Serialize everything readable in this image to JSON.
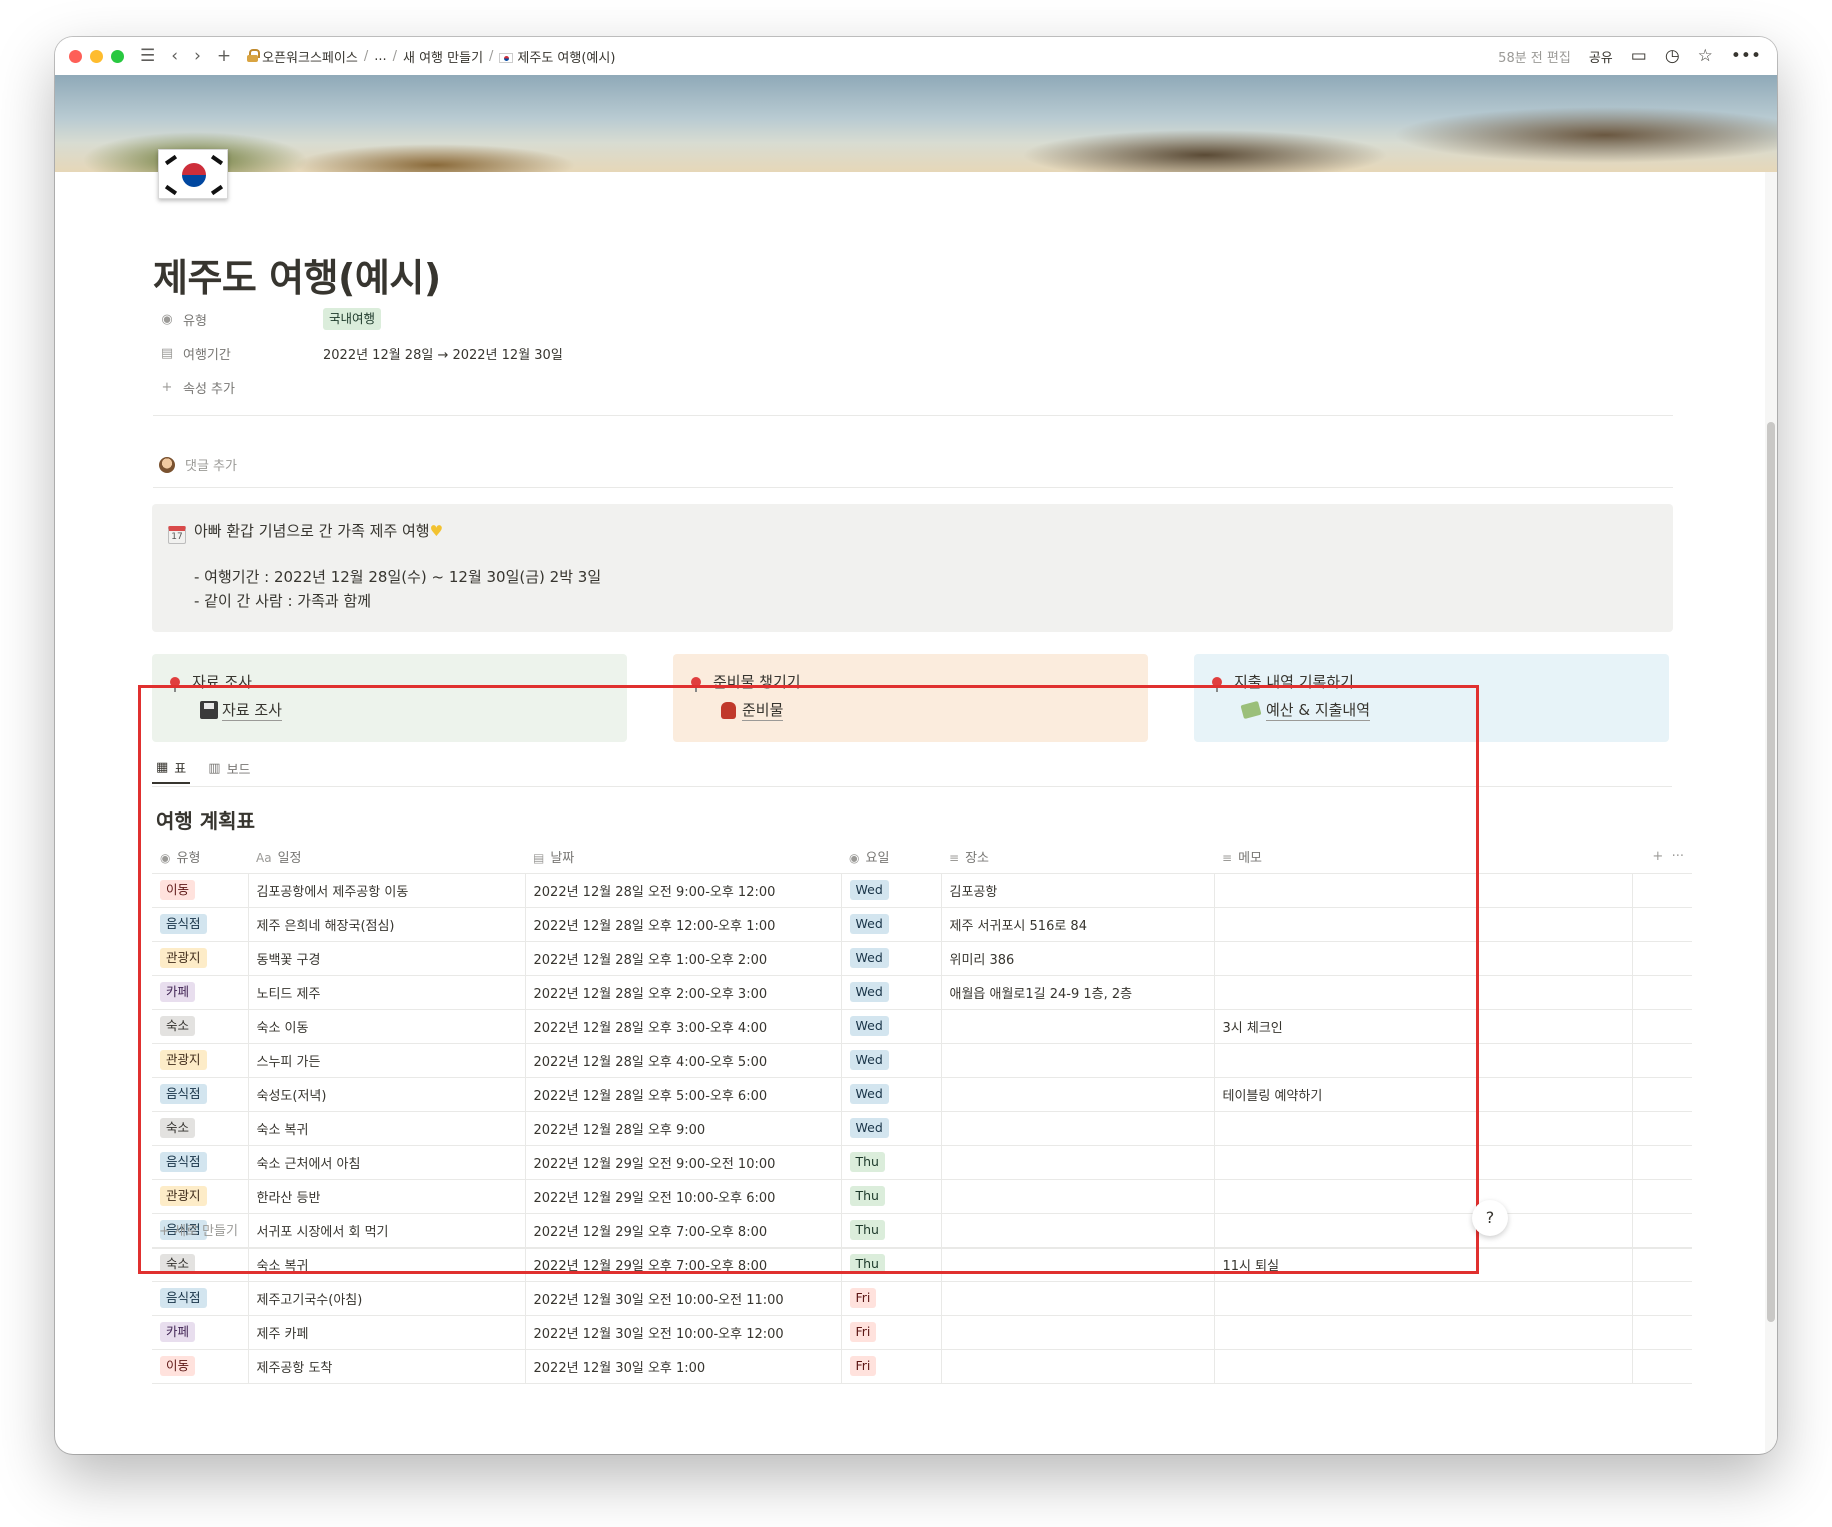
{
  "topbar": {
    "breadcrumbs": [
      "오픈워크스페이스",
      "...",
      "새 여행 만들기",
      "제주도 여행(예시)"
    ],
    "edited": "58분 전 편집",
    "share": "공유"
  },
  "page": {
    "title": "제주도 여행(예시)",
    "properties": [
      {
        "name": "유형",
        "value": "국내여행"
      },
      {
        "name": "여행기간",
        "value": "2022년 12월 28일 → 2022년 12월 30일"
      }
    ],
    "add_property": "속성 추가",
    "add_comment": "댓글 추가"
  },
  "callout": {
    "icon_text": "17",
    "headline": "아빠 환갑 기념으로 간 가족 제주 여행",
    "lines": [
      "- 여행기간 : 2022년 12월 28일(수) ~ 12월 30일(금) 2박 3일",
      "- 같이 간 사람 : 가족과 함께"
    ]
  },
  "cards": [
    {
      "title": "자료 조사",
      "link": "자료 조사"
    },
    {
      "title": "준비물 챙기기",
      "link": "준비물"
    },
    {
      "title": "지출 내역 기록하기",
      "link": "예산 & 지출내역"
    }
  ],
  "database": {
    "tabs": [
      "표",
      "보드"
    ],
    "title": "여행 계획표",
    "columns": [
      "유형",
      "일정",
      "날짜",
      "요일",
      "장소",
      "메모"
    ],
    "column_icon_hint": "Aa",
    "rows": [
      {
        "type": "이동",
        "type_color": "move",
        "name": "김포공항에서 제주공항 이동",
        "date": "2022년 12월 28일 오전 9:00-오후 12:00",
        "day": "Wed",
        "place": "김포공항",
        "memo": ""
      },
      {
        "type": "음식점",
        "type_color": "food",
        "name": "제주 은희네 해장국(점심)",
        "date": "2022년 12월 28일 오후 12:00-오후 1:00",
        "day": "Wed",
        "place": "제주 서귀포시 516로 84",
        "memo": ""
      },
      {
        "type": "관광지",
        "type_color": "sight",
        "name": "동백꽃 구경",
        "date": "2022년 12월 28일 오후 1:00-오후 2:00",
        "day": "Wed",
        "place": "위미리 386",
        "memo": ""
      },
      {
        "type": "카페",
        "type_color": "cafe",
        "name": "노티드 제주",
        "date": "2022년 12월 28일 오후 2:00-오후 3:00",
        "day": "Wed",
        "place": "애월읍 애월로1길 24-9 1층, 2층",
        "memo": ""
      },
      {
        "type": "숙소",
        "type_color": "stay",
        "name": "숙소 이동",
        "date": "2022년 12월 28일 오후 3:00-오후 4:00",
        "day": "Wed",
        "place": "",
        "memo": "3시 체크인"
      },
      {
        "type": "관광지",
        "type_color": "sight",
        "name": "스누피 가든",
        "date": "2022년 12월 28일 오후 4:00-오후 5:00",
        "day": "Wed",
        "place": "",
        "memo": ""
      },
      {
        "type": "음식점",
        "type_color": "food",
        "name": "숙성도(저녁)",
        "date": "2022년 12월 28일 오후 5:00-오후 6:00",
        "day": "Wed",
        "place": "",
        "memo": "테이블링 예약하기"
      },
      {
        "type": "숙소",
        "type_color": "stay",
        "name": "숙소 복귀",
        "date": "2022년 12월 28일 오후 9:00",
        "day": "Wed",
        "place": "",
        "memo": ""
      },
      {
        "type": "음식점",
        "type_color": "food",
        "name": "숙소 근처에서 아침",
        "date": "2022년 12월 29일 오전 9:00-오전 10:00",
        "day": "Thu",
        "place": "",
        "memo": ""
      },
      {
        "type": "관광지",
        "type_color": "sight",
        "name": "한라산 등반",
        "date": "2022년 12월 29일 오전 10:00-오후 6:00",
        "day": "Thu",
        "place": "",
        "memo": ""
      },
      {
        "type": "음식점",
        "type_color": "food",
        "name": "서귀포 시장에서 회 먹기",
        "date": "2022년 12월 29일 오후 7:00-오후 8:00",
        "day": "Thu",
        "place": "",
        "memo": ""
      },
      {
        "type": "숙소",
        "type_color": "stay",
        "name": "숙소 복귀",
        "date": "2022년 12월 29일 오후 7:00-오후 8:00",
        "day": "Thu",
        "place": "",
        "memo": "11시 퇴실"
      },
      {
        "type": "음식점",
        "type_color": "food",
        "name": "제주고기국수(아침)",
        "date": "2022년 12월 30일 오전 10:00-오전 11:00",
        "day": "Fri",
        "place": "",
        "memo": ""
      },
      {
        "type": "카페",
        "type_color": "cafe",
        "name": "제주 카페",
        "date": "2022년 12월 30일 오전 10:00-오후 12:00",
        "day": "Fri",
        "place": "",
        "memo": ""
      },
      {
        "type": "이동",
        "type_color": "move",
        "name": "제주공항 도착",
        "date": "2022년 12월 30일 오후 1:00",
        "day": "Fri",
        "place": "",
        "memo": ""
      }
    ],
    "new_row": "새로 만들기"
  },
  "help": "?"
}
